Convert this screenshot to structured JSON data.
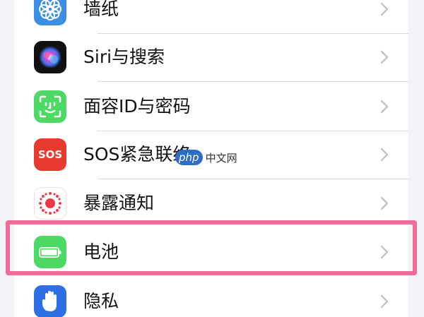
{
  "settings": {
    "items": [
      {
        "label": "墙纸",
        "icon": "wallpaper-flower-icon",
        "color": "#3a8ee6"
      },
      {
        "label": "Siri与搜索",
        "icon": "siri-orb-icon",
        "color": "#1a1a1a"
      },
      {
        "label": "面容ID与密码",
        "icon": "face-id-icon",
        "color": "#4cd964"
      },
      {
        "label": "SOS紧急联络",
        "icon": "sos-icon",
        "color": "#e63b2e"
      },
      {
        "label": "暴露通知",
        "icon": "exposure-notification-icon",
        "color": "#ffffff"
      },
      {
        "label": "电池",
        "icon": "battery-icon",
        "color": "#4cd964"
      },
      {
        "label": "隐私",
        "icon": "privacy-hand-icon",
        "color": "#2f6fe4"
      }
    ],
    "sos_icon_text": "SOS"
  },
  "highlight": {
    "color": "#ef6d98",
    "target": "电池"
  },
  "watermark": {
    "badge": "php",
    "text": "中文网"
  }
}
